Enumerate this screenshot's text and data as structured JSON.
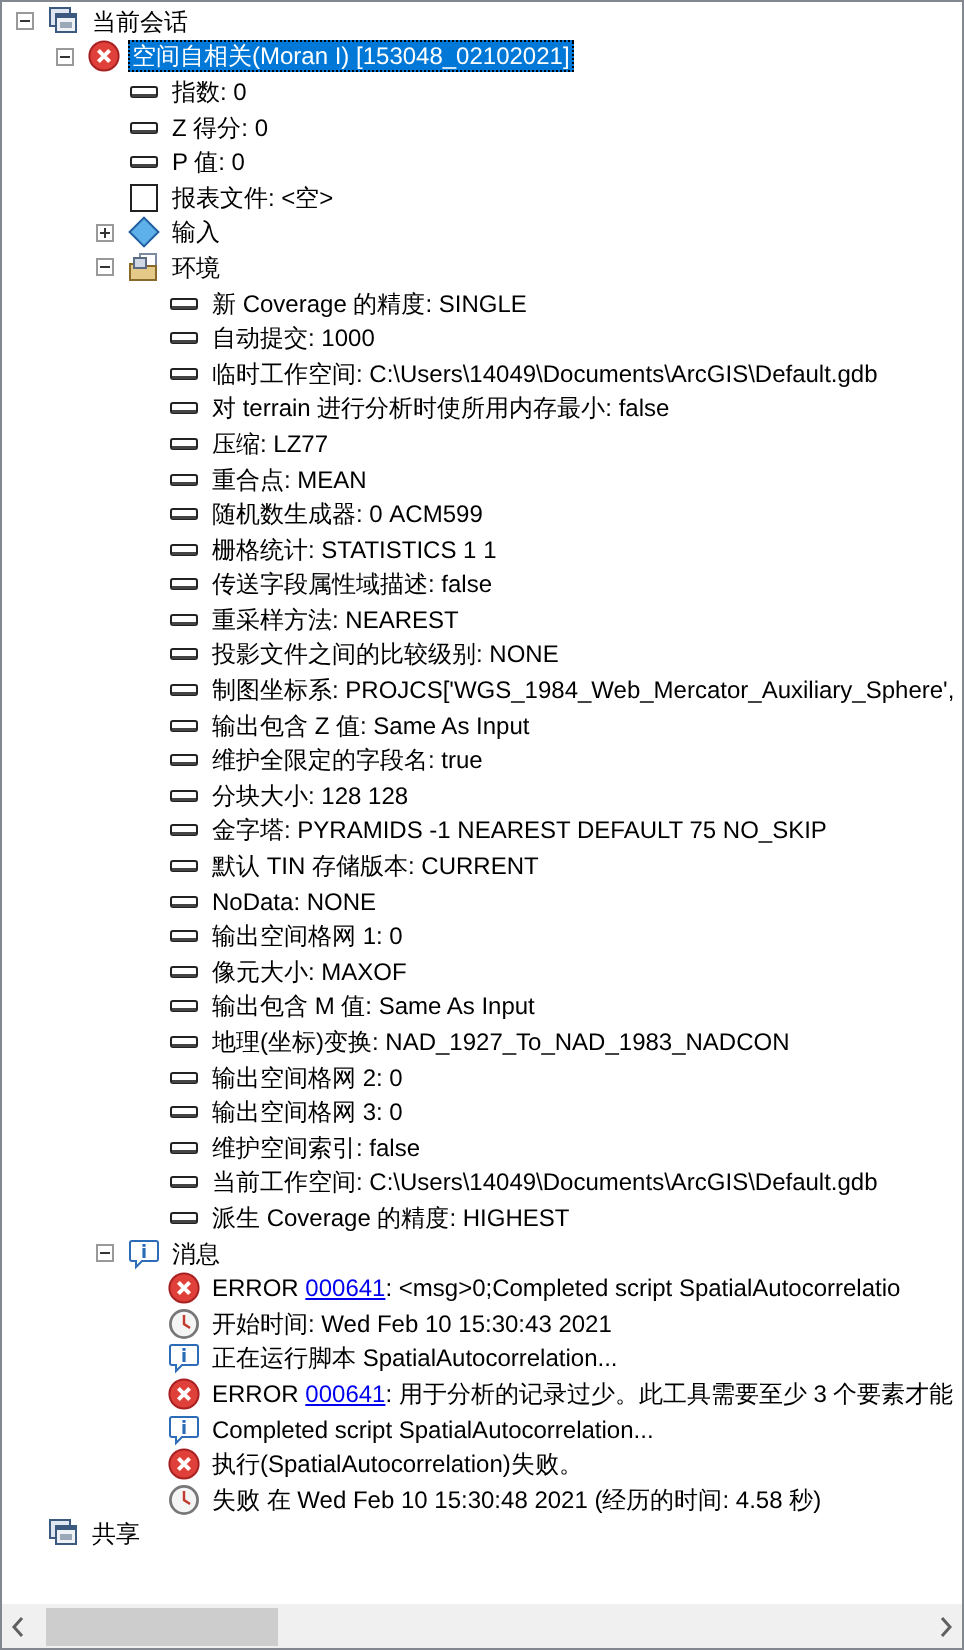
{
  "tree": [
    {
      "kind": "session",
      "label": "当前会话",
      "expanded": true,
      "selected": false,
      "children": [
        {
          "kind": "tool",
          "label": "空间自相关(Moran I) [153048_02102021]",
          "expanded": true,
          "selected": true,
          "children": [
            {
              "kind": "param",
              "label": "指数: 0",
              "selected": false
            },
            {
              "kind": "param",
              "label": "Z 得分: 0",
              "selected": false
            },
            {
              "kind": "param",
              "label": "P 值: 0",
              "selected": false
            },
            {
              "kind": "report",
              "label": "报表文件: <空>",
              "selected": false
            },
            {
              "kind": "input",
              "label": "输入",
              "expanded": false,
              "selected": false
            },
            {
              "kind": "env",
              "label": "环境",
              "expanded": true,
              "selected": false,
              "children": [
                {
                  "kind": "param",
                  "label": "新 Coverage 的精度: SINGLE",
                  "selected": false
                },
                {
                  "kind": "param",
                  "label": "自动提交: 1000",
                  "selected": false
                },
                {
                  "kind": "param",
                  "label": "临时工作空间: C:\\Users\\14049\\Documents\\ArcGIS\\Default.gdb",
                  "selected": false
                },
                {
                  "kind": "param",
                  "label": "对 terrain 进行分析时使所用内存最小: false",
                  "selected": false
                },
                {
                  "kind": "param",
                  "label": "压缩: LZ77",
                  "selected": false
                },
                {
                  "kind": "param",
                  "label": "重合点: MEAN",
                  "selected": false
                },
                {
                  "kind": "param",
                  "label": "随机数生成器: 0 ACM599",
                  "selected": false
                },
                {
                  "kind": "param",
                  "label": "栅格统计: STATISTICS 1 1",
                  "selected": false
                },
                {
                  "kind": "param",
                  "label": "传送字段属性域描述: false",
                  "selected": false
                },
                {
                  "kind": "param",
                  "label": "重采样方法: NEAREST",
                  "selected": false
                },
                {
                  "kind": "param",
                  "label": "投影文件之间的比较级别: NONE",
                  "selected": false
                },
                {
                  "kind": "param",
                  "label": "制图坐标系: PROJCS['WGS_1984_Web_Mercator_Auxiliary_Sphere',",
                  "selected": false
                },
                {
                  "kind": "param",
                  "label": "输出包含 Z 值: Same As Input",
                  "selected": false
                },
                {
                  "kind": "param",
                  "label": "维护全限定的字段名: true",
                  "selected": false
                },
                {
                  "kind": "param",
                  "label": "分块大小: 128 128",
                  "selected": false
                },
                {
                  "kind": "param",
                  "label": "金字塔: PYRAMIDS -1 NEAREST DEFAULT 75 NO_SKIP",
                  "selected": false
                },
                {
                  "kind": "param",
                  "label": "默认 TIN 存储版本: CURRENT",
                  "selected": false
                },
                {
                  "kind": "param",
                  "label": "NoData: NONE",
                  "selected": false
                },
                {
                  "kind": "param",
                  "label": "输出空间格网 1: 0",
                  "selected": false
                },
                {
                  "kind": "param",
                  "label": "像元大小: MAXOF",
                  "selected": false
                },
                {
                  "kind": "param",
                  "label": "输出包含 M 值: Same As Input",
                  "selected": false
                },
                {
                  "kind": "param",
                  "label": "地理(坐标)变换: NAD_1927_To_NAD_1983_NADCON",
                  "selected": false
                },
                {
                  "kind": "param",
                  "label": "输出空间格网 2: 0",
                  "selected": false
                },
                {
                  "kind": "param",
                  "label": "输出空间格网 3: 0",
                  "selected": false
                },
                {
                  "kind": "param",
                  "label": "维护空间索引: false",
                  "selected": false
                },
                {
                  "kind": "param",
                  "label": "当前工作空间: C:\\Users\\14049\\Documents\\ArcGIS\\Default.gdb",
                  "selected": false
                },
                {
                  "kind": "param",
                  "label": "派生 Coverage 的精度: HIGHEST",
                  "selected": false
                }
              ]
            },
            {
              "kind": "info",
              "label": "消息",
              "expanded": true,
              "selected": false,
              "children": [
                {
                  "kind": "error",
                  "label": "ERROR ",
                  "link": "000641",
                  "label_after": ": <msg>0;Completed script SpatialAutocorrelatio",
                  "selected": false
                },
                {
                  "kind": "clock",
                  "label": "开始时间: Wed Feb 10 15:30:43 2021",
                  "selected": false
                },
                {
                  "kind": "info",
                  "label": "正在运行脚本 SpatialAutocorrelation...",
                  "selected": false
                },
                {
                  "kind": "error",
                  "label": "ERROR ",
                  "link": "000641",
                  "label_after": ": 用于分析的记录过少。此工具需要至少 3 个要素才能",
                  "selected": false
                },
                {
                  "kind": "info",
                  "label": "Completed script SpatialAutocorrelation...",
                  "selected": false
                },
                {
                  "kind": "error",
                  "label": "执行(SpatialAutocorrelation)失败。",
                  "selected": false
                },
                {
                  "kind": "clock",
                  "label": "失败 在 Wed Feb 10 15:30:48 2021 (经历的时间: 4.58 秒)",
                  "selected": false
                }
              ]
            }
          ]
        }
      ]
    },
    {
      "kind": "session",
      "label": "共享",
      "selected": false
    }
  ]
}
